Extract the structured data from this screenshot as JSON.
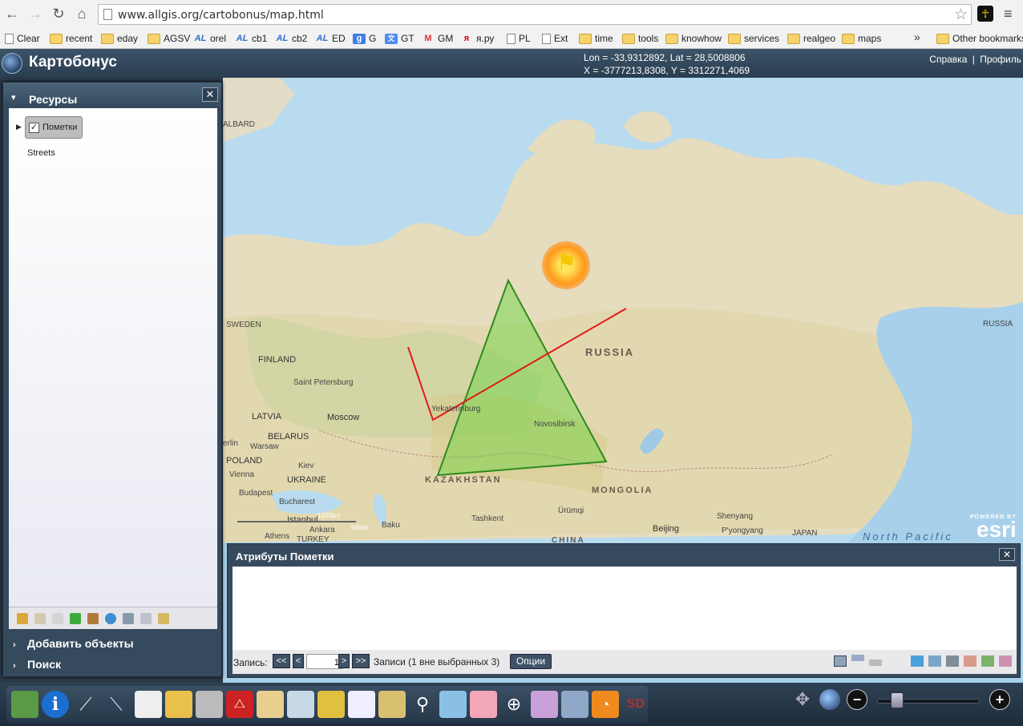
{
  "browser": {
    "url": "www.allgis.org/cartobonus/map.html",
    "bookmarks": [
      {
        "label": "Clear",
        "icon": "doc-icon"
      },
      {
        "label": "recent",
        "icon": "folder-icon"
      },
      {
        "label": "eday",
        "icon": "folder-icon"
      },
      {
        "label": "AGSV",
        "icon": "folder-icon"
      },
      {
        "label": "orel",
        "icon": "al-icon"
      },
      {
        "label": "cb1",
        "icon": "al-icon"
      },
      {
        "label": "cb2",
        "icon": "al-icon"
      },
      {
        "label": "ED",
        "icon": "al-icon"
      },
      {
        "label": "G",
        "icon": "google-icon"
      },
      {
        "label": "GT",
        "icon": "translate-icon"
      },
      {
        "label": "GM",
        "icon": "gmail-icon"
      },
      {
        "label": "я.ру",
        "icon": "ya-icon"
      },
      {
        "label": "PL",
        "icon": "doc-icon"
      },
      {
        "label": "Ext",
        "icon": "doc-icon"
      },
      {
        "label": "time",
        "icon": "folder-icon"
      },
      {
        "label": "tools",
        "icon": "folder-icon"
      },
      {
        "label": "knowhow",
        "icon": "folder-icon"
      },
      {
        "label": "services",
        "icon": "folder-icon"
      },
      {
        "label": "realgeo",
        "icon": "folder-icon"
      },
      {
        "label": "maps",
        "icon": "folder-icon"
      }
    ],
    "more": "»",
    "other_bookmarks": "Other bookmarks"
  },
  "app": {
    "title": "Картобонус",
    "coord_geo": "Lon = -33,9312892, Lat = 28,5008806",
    "coord_proj": "X = -3777213,8308, Y = 3312271,4069",
    "help_link": "Справка",
    "separator": "|",
    "profile_link": "Профиль"
  },
  "resources_panel": {
    "title": "Ресурсы",
    "close": "✕",
    "layers": [
      {
        "label": "Пометки",
        "checked": true
      },
      {
        "label": "Streets"
      }
    ],
    "sections": [
      {
        "label": "Добавить объекты"
      },
      {
        "label": "Поиск"
      }
    ]
  },
  "map": {
    "labels": {
      "russia": "RUSSIA",
      "russia_e": "RUSSIA",
      "kazakhstan": "KAZAKHSTAN",
      "mongolia": "MONGOLIA",
      "china": "CHINA",
      "japan": "JAPAN",
      "sweden": "SWEDEN",
      "finland": "FINLAND",
      "latvia": "LATVIA",
      "belarus": "BELARUS",
      "poland": "POLAND",
      "ukraine": "UKRAINE",
      "turkey": "TURKEY",
      "svalbard": "ALBARD",
      "north_pacific": "North Pacific",
      "moscow": "Moscow",
      "spb": "Saint Petersburg",
      "yekaterinburg": "Yekaterinburg",
      "novosibirsk": "Novosibirsk",
      "warsaw": "Warsaw",
      "kiev": "Kiev",
      "vienna": "Vienna",
      "budapest": "Budapest",
      "bucharest": "Bucharest",
      "istanbul": "Istanbul",
      "ankara": "Ankara",
      "athens": "Athens",
      "baku": "Baku",
      "tashkent": "Tashkent",
      "urumqi": "Ürümqi",
      "beijing": "Beijing",
      "shenyang": "Shenyang",
      "pyongyang": "P'yongyang",
      "berlin": "erlin"
    },
    "scale_km": "1000km",
    "scale_mi": "900mi",
    "powered_by": "POWERED BY",
    "brand": "esri"
  },
  "attributes_panel": {
    "title": "Атрибуты Пометки",
    "close": "✕",
    "record_label": "Запись:",
    "first": "<<",
    "prev": "<",
    "record_value": "1",
    "next": ">",
    "last": ">>",
    "records_info": "Записи (1 вне выбранных 3)",
    "options": "Опции"
  },
  "toolbar": {
    "sd_label": "SD",
    "zoom_out": "−",
    "zoom_in": "+",
    "zoom_level": 0.15
  }
}
